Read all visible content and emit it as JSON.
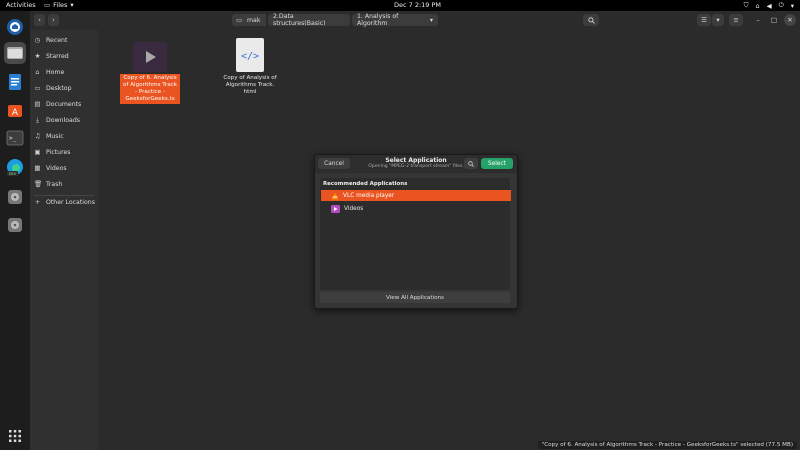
{
  "topbar": {
    "activities": "Activities",
    "app_name": "Files",
    "clock": "Dec 7  2:19 PM"
  },
  "dock": {
    "icons": [
      "home-browser-icon",
      "files-icon",
      "writer-icon",
      "software-icon",
      "terminal-icon",
      "edge-dev-icon",
      "disc-icon",
      "disc-icon",
      "apps-grid-icon"
    ],
    "edge_badge": "DEV"
  },
  "header": {
    "breadcrumbs": [
      "mak",
      "2.Data structures(Basic)",
      "1. Analysis of Algorithm"
    ]
  },
  "sidebar": {
    "items": [
      {
        "icon": "◷",
        "label": "Recent"
      },
      {
        "icon": "★",
        "label": "Starred"
      },
      {
        "icon": "⌂",
        "label": "Home"
      },
      {
        "icon": "▭",
        "label": "Desktop"
      },
      {
        "icon": "▤",
        "label": "Documents"
      },
      {
        "icon": "⤓",
        "label": "Downloads"
      },
      {
        "icon": "♫",
        "label": "Music"
      },
      {
        "icon": "▣",
        "label": "Pictures"
      },
      {
        "icon": "▦",
        "label": "Videos"
      },
      {
        "icon": "🗑",
        "label": "Trash"
      }
    ],
    "other": {
      "icon": "+",
      "label": "Other Locations"
    }
  },
  "files": [
    {
      "name": "Copy of 6. Analysis of Algorithms Track - Practice - GeeksforGeeks.ts",
      "type": "video",
      "selected": true
    },
    {
      "name": "Copy of Analysis of Algorithms Track. html",
      "type": "html",
      "selected": false
    }
  ],
  "dialog": {
    "title": "Select Application",
    "subtitle": "Opening \"MPEG-2 transport stream\" files.",
    "cancel": "Cancel",
    "select": "Select",
    "section": "Recommended Applications",
    "apps": [
      {
        "name": "VLC media player",
        "selected": true
      },
      {
        "name": "Videos",
        "selected": false
      }
    ],
    "view_all": "View All Applications"
  },
  "status": "\"Copy of 6. Analysis of Algorithms Track - Practice - GeeksforGeeks.ts\" selected  (77.5 MB)",
  "colors": {
    "accent": "#e95420",
    "select_button": "#26a269"
  }
}
